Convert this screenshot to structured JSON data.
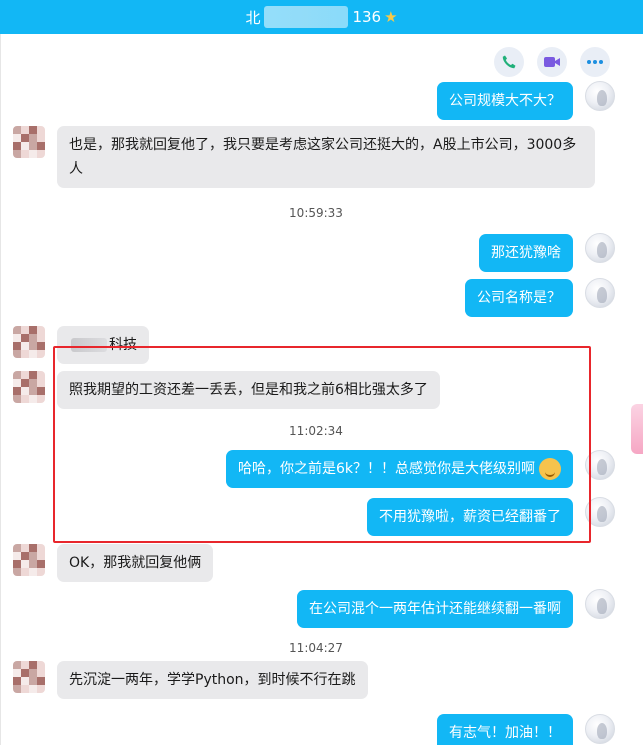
{
  "header": {
    "title_left": "北",
    "title_right": "136",
    "star_icon": "star-icon",
    "bg": "#12b7f5"
  },
  "toolbar": {
    "icons": [
      "phone-icon",
      "video-icon",
      "more-icon"
    ]
  },
  "colors": {
    "outgoing": "#12b7f5",
    "incoming": "#e9e9eb",
    "highlight": "#e8262c"
  },
  "messages": [
    {
      "side": "right",
      "text": "公司规模大不大？"
    },
    {
      "side": "left",
      "text": "也是，那我就回复他了，我只要是考虑这家公司还挺大的，A股上市公司，3000多人"
    },
    {
      "side": "time",
      "text": "10:59:33"
    },
    {
      "side": "right",
      "text": "那还犹豫啥"
    },
    {
      "side": "right",
      "text": "公司名称是？"
    },
    {
      "side": "left",
      "text": "科技"
    },
    {
      "side": "left",
      "text": "照我期望的工资还差一丢丢，但是和我之前6相比强太多了"
    },
    {
      "side": "time",
      "text": "11:02:34"
    },
    {
      "side": "right",
      "text": "哈哈，你之前是6k？！！总感觉你是大佬级别啊"
    },
    {
      "side": "right",
      "text": "不用犹豫啦，薪资已经翻番了"
    },
    {
      "side": "left",
      "text": "OK，那我就回复他俩"
    },
    {
      "side": "right",
      "text": "在公司混个一两年估计还能继续翻一番啊"
    },
    {
      "side": "time",
      "text": "11:04:27"
    },
    {
      "side": "left",
      "text": "先沉淀一两年，学学Python，到时候不行在跳"
    },
    {
      "side": "right",
      "text": "有志气！加油！！"
    }
  ]
}
